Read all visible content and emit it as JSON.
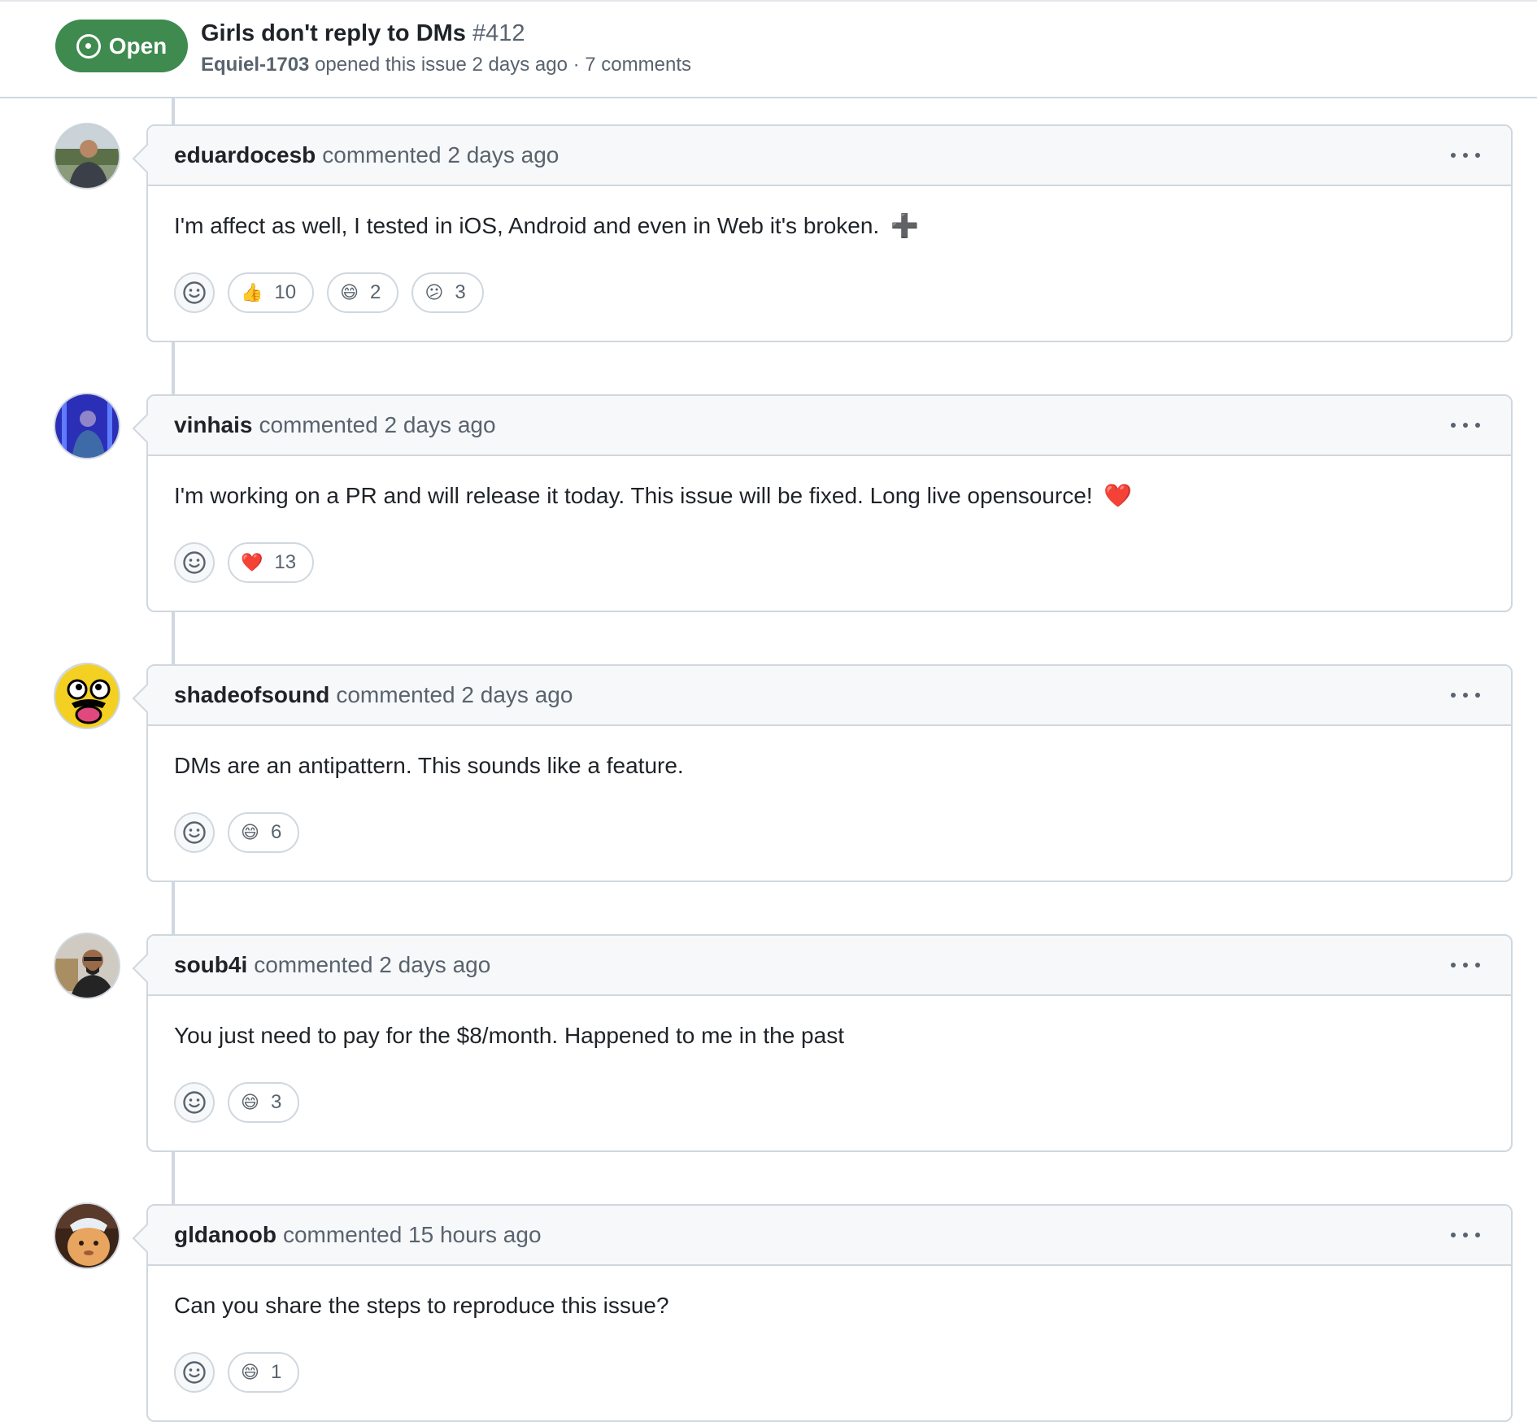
{
  "issue": {
    "state": "Open",
    "title": "Girls don't reply to DMs",
    "number": "#412",
    "author": "Equiel-1703",
    "meta_text": "opened this issue 2 days ago · 7 comments"
  },
  "comments": [
    {
      "user": "eduardocesb",
      "action": "commented 2 days ago",
      "body": "I'm affect as well, I tested in iOS, Android and even in Web it's broken.",
      "body_emoji": "➕",
      "reactions": [
        {
          "emoji": "👍",
          "count": "10"
        },
        {
          "emoji": "😄",
          "count": "2"
        },
        {
          "emoji": "😕",
          "count": "3"
        }
      ]
    },
    {
      "user": "vinhais",
      "action": "commented 2 days ago",
      "body": "I'm working on a PR and will release it today. This issue will be fixed. Long live opensource!",
      "body_emoji": "❤️",
      "reactions": [
        {
          "emoji": "❤️",
          "count": "13"
        }
      ]
    },
    {
      "user": "shadeofsound",
      "action": "commented 2 days ago",
      "body": "DMs are an antipattern. This sounds like a feature.",
      "body_emoji": "",
      "reactions": [
        {
          "emoji": "😄",
          "count": "6"
        }
      ]
    },
    {
      "user": "soub4i",
      "action": "commented 2 days ago",
      "body": "You just need to pay for the $8/month. Happened to me in the past",
      "body_emoji": "",
      "reactions": [
        {
          "emoji": "😄",
          "count": "3"
        }
      ]
    },
    {
      "user": "gldanoob",
      "action": "commented 15 hours ago",
      "body": "Can you share the steps to reproduce this issue?",
      "body_emoji": "",
      "reactions": [
        {
          "emoji": "😄",
          "count": "1"
        }
      ]
    }
  ],
  "colors": {
    "open_green": "#3f8a4f",
    "border": "#d0d7de",
    "muted_text": "#59636e",
    "header_bg": "#f6f8fa"
  }
}
